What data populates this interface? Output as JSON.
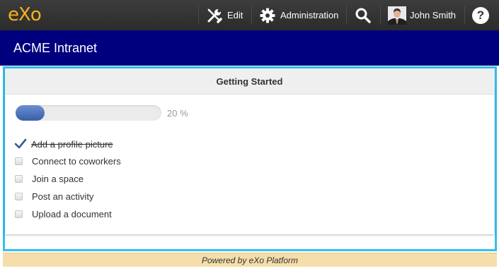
{
  "topbar": {
    "logo": {
      "e": "e",
      "x": "X",
      "o": "o"
    },
    "edit_label": "Edit",
    "administration_label": "Administration",
    "user_name": "John Smith",
    "help_label": "?"
  },
  "site": {
    "title": "ACME Intranet"
  },
  "getting_started": {
    "title": "Getting Started",
    "progress_percent": 20,
    "progress_label": "20 %",
    "tasks": [
      {
        "label": "Add a profile picture",
        "done": true
      },
      {
        "label": "Connect to coworkers",
        "done": false
      },
      {
        "label": "Join a space",
        "done": false
      },
      {
        "label": "Post an activity",
        "done": false
      },
      {
        "label": "Upload a document",
        "done": false
      }
    ]
  },
  "footer": {
    "text": "Powered by eXo Platform"
  },
  "colors": {
    "topbar": "#333333",
    "logo": "#f6b21b",
    "site_bar": "#00007f",
    "frame_border": "#33c0f0",
    "progress_fill": "#4a6db6",
    "footer": "#f6deaa"
  }
}
